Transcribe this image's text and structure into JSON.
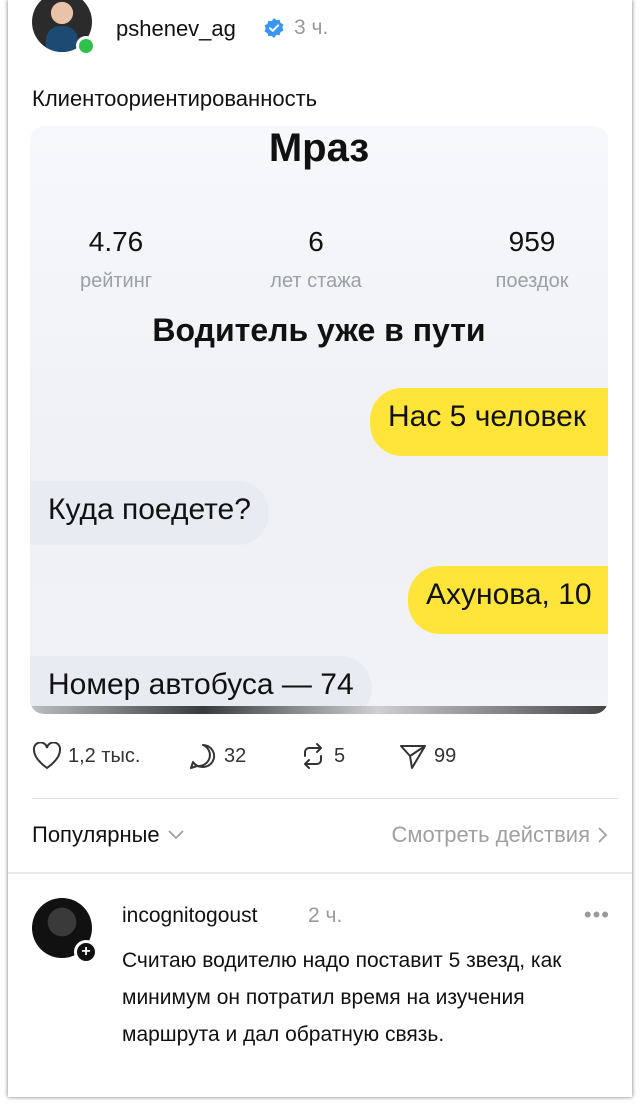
{
  "post": {
    "username": "pshenev_ag",
    "time": "3 ч.",
    "caption": "Клиентоориентированность",
    "accent_verified": "#3897f0",
    "online_color": "#2fc14b"
  },
  "image": {
    "driver_name": "Мраз",
    "stats": [
      {
        "value": "4.76",
        "label": "рейтинг"
      },
      {
        "value": "6",
        "label": "лет стажа"
      },
      {
        "value": "959",
        "label": "поездок"
      }
    ],
    "status": "Водитель уже в пути",
    "messages": [
      {
        "side": "out",
        "text": "Нас 5 человек"
      },
      {
        "side": "in",
        "text": "Куда поедете?"
      },
      {
        "side": "out",
        "text": "Ахунова, 10"
      },
      {
        "side": "in",
        "text": "Номер автобуса — 74"
      }
    ],
    "bubble_out_color": "#ffe53a",
    "bubble_in_color": "#e8ebf1"
  },
  "actions": {
    "likes": "1,2 тыс.",
    "comments": "32",
    "reposts": "5",
    "shares": "99"
  },
  "sort": {
    "label": "Популярные",
    "activity_link": "Смотреть действия"
  },
  "comment": {
    "username": "incognitogoust",
    "time": "2 ч.",
    "more": "•••",
    "text": "Считаю водителю надо поставит 5 звезд, как минимум он потратил время на изучения маршрута и дал обратную связь."
  }
}
